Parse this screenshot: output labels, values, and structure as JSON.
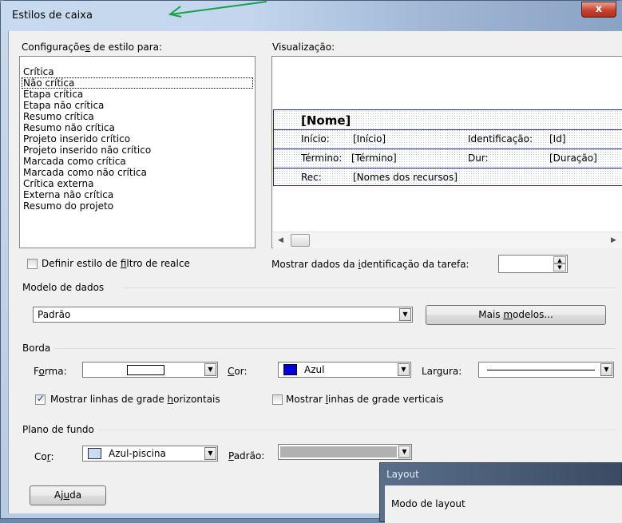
{
  "window": {
    "title": "Estilos de caixa",
    "close_label": "x"
  },
  "style_settings": {
    "label_pre": "Configuraçõe",
    "label_underline": "s",
    "label_post": " de estilo para:",
    "items": [
      "Crítica",
      "Não crítica",
      "Etapa crítica",
      "Etapa não crítica",
      "Resumo crítica",
      "Resumo não crítica",
      "Projeto inserido crítico",
      "Projeto inserido não crítico",
      "Marcada como crítica",
      "Marcada como não crítica",
      "Crítica externa",
      "Externa não crítica",
      "Resumo do projeto"
    ],
    "selected_index": 1
  },
  "preview": {
    "label": "Visualização:",
    "name": "[Nome]",
    "row1": {
      "start_label": "Início:",
      "start_value": "[Início]",
      "id_label": "Identificação:",
      "id_value": "[Id]"
    },
    "row2": {
      "finish_label": "Término:",
      "finish_value": "[Término]",
      "dur_label": "Dur:",
      "dur_value": "[Duração]"
    },
    "row3": {
      "res_label": "Rec:",
      "res_value": "[Nomes dos recursos]"
    },
    "scroll_left": "◀",
    "scroll_right": "▶"
  },
  "highlight_filter": {
    "pre": "Definir estilo de ",
    "u": "f",
    "post": "iltro de realce",
    "checked": false
  },
  "task_id": {
    "pre": "Mostrar dados da ",
    "u": "i",
    "post": "dentificação da tarefa:",
    "value": ""
  },
  "data_template": {
    "section": "Modelo de dados",
    "value": "Padrão",
    "more_pre": "Mais ",
    "more_u": "m",
    "more_post": "odelos..."
  },
  "border": {
    "section": "Borda",
    "shape_pre": "F",
    "shape_u": "o",
    "shape_post": "rma:",
    "color_u": "C",
    "color_post": "or:",
    "color_value": "Azul",
    "color_hex": "#0000dd",
    "width_pre": "Lar",
    "width_u": "g",
    "width_post": "ura:",
    "hgrid_pre": "Mostrar linhas de grade ",
    "hgrid_u": "h",
    "hgrid_post": "orizontais",
    "hgrid_checked": true,
    "vgrid_pre": "Mostrar ",
    "vgrid_u": "l",
    "vgrid_post": "inhas de grade verticais",
    "vgrid_checked": false
  },
  "background": {
    "section": "Plano de fundo",
    "color_pre": "Co",
    "color_u": "r",
    "color_post": ":",
    "color_value": "Azul-piscina",
    "color_hex": "#c9dcf3",
    "pattern_pre": "",
    "pattern_u": "P",
    "pattern_post": "adrão:"
  },
  "help": {
    "pre": "Aj",
    "u": "u",
    "post": "da"
  },
  "layout_dialog": {
    "title": "Layout",
    "section": "Modo de layout"
  }
}
